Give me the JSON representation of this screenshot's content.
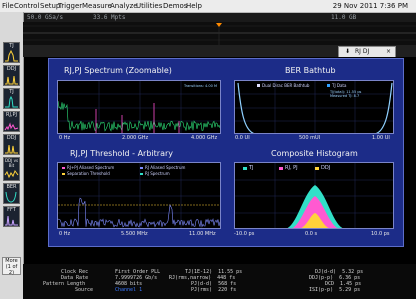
{
  "menu": {
    "items": [
      "File",
      "Control",
      "Setup",
      "Trigger",
      "Measure",
      "Analyze",
      "Utilities",
      "Demos",
      "Help"
    ],
    "datetime": "29 Nov 2011  7:36 PM"
  },
  "acquisition": {
    "sample_rate": "50.0 GSa/s",
    "memory": "33.6 Mpts",
    "scale": "11.0 GB"
  },
  "sidebar": {
    "buttons": [
      {
        "label": "TJ",
        "wave_color": "#ffd23a"
      },
      {
        "label": "DDJ",
        "wave_color": "#ffd23a"
      },
      {
        "label": "TJ",
        "wave_color": "#31e0c8"
      },
      {
        "label": "RJ,PJ",
        "wave_color": "#ff5ad1"
      },
      {
        "label": "DDJ",
        "wave_color": "#ffd23a"
      },
      {
        "label": "DDJ vs Bit",
        "wave_color": "#ffd23a"
      },
      {
        "label": "BER",
        "wave_color": "#31e0c8"
      },
      {
        "label": "FFT",
        "wave_color": "#c9a3ff"
      }
    ],
    "more_label": "More",
    "more_page": "(1 of 2)"
  },
  "tab": {
    "label": "RJ DJ",
    "arrow": "⬇",
    "close": "×"
  },
  "panels": {
    "spectrum": {
      "title": "RJ,PJ Spectrum   (Zoomable)",
      "x_ticks": [
        "0 Hz",
        "2.000 GHz",
        "4.000 GHz"
      ],
      "note": "Transitions: 4.00 M",
      "trace_color": "#2ee07a",
      "spur_color": "#ff4fd1"
    },
    "bathtub": {
      "title": "BER Bathtub",
      "legend": [
        "Dual Dirac BER Bathtub",
        "TJ Data"
      ],
      "note_lines": [
        "TJ(total): 11.55 ps",
        "Measured TJ: 8.7"
      ],
      "x_ticks": [
        "0.0 UI",
        "500 mUI",
        "1.00 UI"
      ],
      "curve_color": "#8fd0ff"
    },
    "threshold": {
      "title": "RJ,PJ Threshold - Arbitrary",
      "legend": [
        "RJ+PJ Aliased Spectrum",
        "RJ Aliased Spectrum",
        "Separation Threshold",
        "RJ Spectrum"
      ],
      "x_ticks": [
        "0 Hz",
        "5.500 MHz",
        "11.00 MHz"
      ],
      "trace_color": "#7f8cff"
    },
    "histogram": {
      "title": "Composite Histogram",
      "legend": [
        "TJ",
        "RJ, PJ",
        "DDJ"
      ],
      "legend_colors": [
        "#31e0c8",
        "#ff5ad1",
        "#ffd23a"
      ],
      "x_ticks": [
        "-10.0 ps",
        "0.0 s",
        "10.0 ps"
      ]
    }
  },
  "readouts": {
    "left_labels": [
      "Clock Rec",
      "Data Rate",
      "Pattern Length",
      "Source"
    ],
    "left_values": [
      "First Order PLL",
      "7.9999726 Gb/s",
      "4608 bits",
      "Channel 1"
    ],
    "mid": [
      "TJ(1E-12)  11.55 ps",
      "RJ(rms,narrow)  448 fs",
      "PJ(d-d)  568 fs",
      "PJ(rms)  220 fs"
    ],
    "right": [
      "DJ(d-d)  5.32 ps",
      "DDJ(p-p)  6.36 ps",
      "DCD  1.45 ps",
      "ISI(p-p)  5.29 ps"
    ]
  }
}
